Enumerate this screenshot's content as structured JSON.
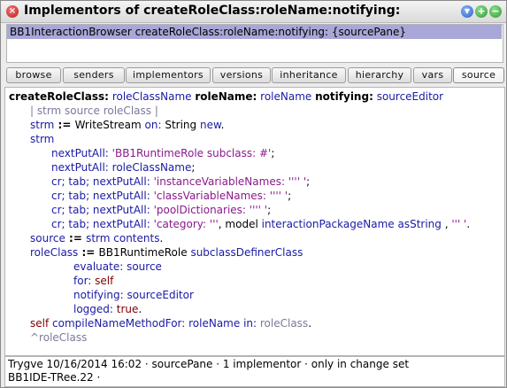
{
  "window": {
    "title": "Implementors of createRoleClass:roleName:notifying:",
    "menu_icon": "chevron-down-icon",
    "expand_icon": "plus-icon",
    "collapse_icon": "minus-icon",
    "close_icon": "close-icon"
  },
  "list": {
    "items": [
      "BB1InteractionBrowser createRoleClass:roleName:notifying: {sourcePane}"
    ]
  },
  "buttons": {
    "browse": "browse",
    "senders": "senders",
    "implementors": "implementors",
    "versions": "versions",
    "inheritance": "inheritance",
    "hierarchy": "hierarchy",
    "vars": "vars",
    "source": "source"
  },
  "code": {
    "l1": {
      "s1": "createRoleClass:",
      "a1": "roleClassName",
      "s2": "roleName:",
      "a2": "roleName",
      "s3": "notifying:",
      "a3": "sourceEditor"
    },
    "l2": {
      "t": "| strm source roleClass |"
    },
    "l3": {
      "v": "strm",
      "op": " := ",
      "cls": "WriteStream ",
      "m": "on:",
      "cls2": " String ",
      "m2": "new",
      "end": "."
    },
    "l4": {
      "v": "strm"
    },
    "l5": {
      "m": "nextPutAll:",
      "s": " 'BB1RuntimeRole subclass: #'",
      "end": ";"
    },
    "l6": {
      "m": "nextPutAll:",
      "v": " roleClassName",
      "end": ";"
    },
    "l7": {
      "m": "cr; tab; nextPutAll:",
      "s": " 'instanceVariableNames: '''' '",
      "end": ";"
    },
    "l8": {
      "m": "cr; tab; nextPutAll:",
      "s": " 'classVariableNames: '''' '",
      "end": ";"
    },
    "l9": {
      "m": "cr; tab; nextPutAll:",
      "s": " 'poolDictionaries: '''' '",
      "end": ";"
    },
    "l10": {
      "m": "cr; tab; nextPutAll:",
      "s": " 'category: '''",
      "c": ", model ",
      "m2": "interactionPackageName asString",
      "c2": " , ",
      "s2": "''' '",
      "end": "."
    },
    "l11": {
      "v": "source",
      "op": " := ",
      "v2": "strm ",
      "m": "contents",
      "end": "."
    },
    "l12": {
      "v": "roleClass",
      "op": " := ",
      "cls": "BB1RuntimeRole ",
      "m": "subclassDefinerClass"
    },
    "l13": {
      "m": "evaluate:",
      "v": " source"
    },
    "l14": {
      "m": "for:",
      "p": " self"
    },
    "l15": {
      "m": "notifying:",
      "v": " sourceEditor"
    },
    "l16": {
      "m": "logged:",
      "p": " true",
      "end": "."
    },
    "l17": {
      "p": "self ",
      "m": "compileNameMethodFor:",
      "v": " roleName ",
      "m2": "in:",
      "v2": " roleClass",
      "end": "."
    },
    "l18": {
      "r": "^roleClass"
    }
  },
  "status": {
    "line1": "Trygve 10/16/2014 16:02 · sourcePane · 1 implementor · only in change set",
    "line2": "BB1IDE-TRee.22   ·"
  }
}
